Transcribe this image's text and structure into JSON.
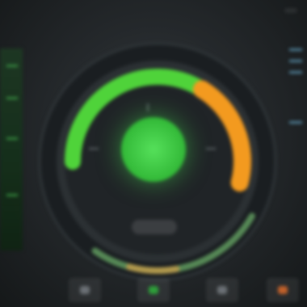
{
  "header": {
    "app_title": "",
    "right_label": ""
  },
  "gauge": {
    "center_value": "",
    "mid_label": "",
    "sub_label": "",
    "level_fraction": 0.72,
    "colors": {
      "green": "#4fd33a",
      "orange": "#f39a1f",
      "track": "#1c2023",
      "inner_ring": "#2b3033"
    }
  },
  "columns": {
    "left_label": "",
    "right_label": ""
  },
  "icons": {
    "bottom": [
      "status-icon",
      "status-icon",
      "status-icon",
      "status-icon"
    ]
  }
}
